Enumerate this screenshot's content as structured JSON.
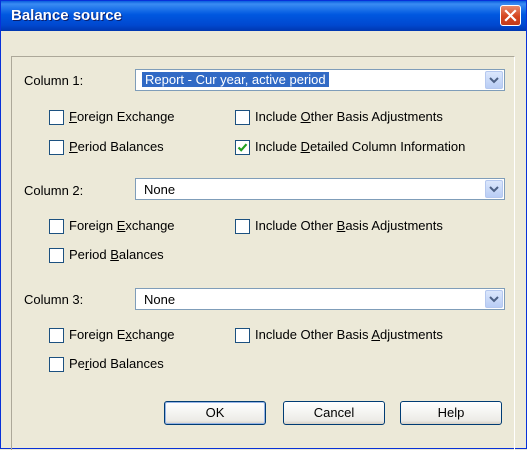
{
  "window": {
    "title": "Balance source"
  },
  "columns": [
    {
      "label": "Column 1:",
      "value": "Report - Cur year, active period",
      "foreign_exchange": {
        "pre": "",
        "key": "F",
        "post": "oreign Exchange",
        "checked": false
      },
      "other_basis": {
        "pre": "Include ",
        "key": "O",
        "post": "ther Basis Adjustments",
        "checked": false
      },
      "period_balances": {
        "pre": "",
        "key": "P",
        "post": "eriod Balances",
        "checked": false
      },
      "detailed": {
        "pre": "Include ",
        "key": "D",
        "post": "etailed Column Information",
        "checked": true
      }
    },
    {
      "label": "Column 2:",
      "value": "None",
      "foreign_exchange": {
        "pre": "Foreign ",
        "key": "E",
        "post": "xchange",
        "checked": false
      },
      "other_basis": {
        "pre": "Include Other ",
        "key": "B",
        "post": "asis Adjustments",
        "checked": false
      },
      "period_balances": {
        "pre": "Period ",
        "key": "B",
        "post": "alances",
        "checked": false
      }
    },
    {
      "label": "Column 3:",
      "value": "None",
      "foreign_exchange": {
        "pre": "Foreign E",
        "key": "x",
        "post": "change",
        "checked": false
      },
      "other_basis": {
        "pre": "Include Other Basis ",
        "key": "A",
        "post": "djustments",
        "checked": false
      },
      "period_balances": {
        "pre": "Pe",
        "key": "r",
        "post": "iod Balances",
        "checked": false
      }
    }
  ],
  "buttons": {
    "ok": "OK",
    "cancel": "Cancel",
    "help": "Help"
  },
  "icons": {
    "close": "close-icon",
    "dropdown": "chevron-down-icon",
    "check": "checkmark-icon"
  }
}
